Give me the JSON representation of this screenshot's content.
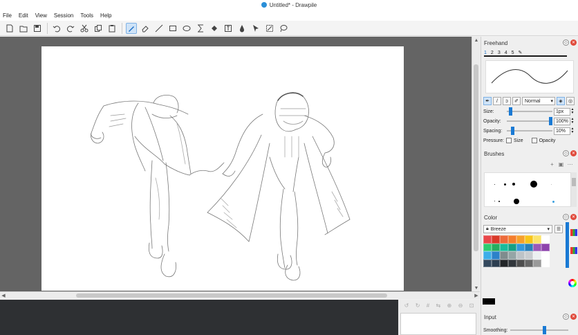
{
  "window": {
    "title": "Untitled* - Drawpile"
  },
  "menu": [
    "File",
    "Edit",
    "View",
    "Session",
    "Tools",
    "Help"
  ],
  "toolbar": {
    "items": [
      {
        "name": "new-icon"
      },
      {
        "name": "open-icon"
      },
      {
        "name": "save-icon"
      },
      {
        "name": "undo-icon"
      },
      {
        "name": "redo-icon"
      },
      {
        "name": "cut-icon"
      },
      {
        "name": "copy-icon"
      },
      {
        "name": "paste-icon"
      },
      {
        "name": "freehand-icon",
        "active": true
      },
      {
        "name": "eraser-icon"
      },
      {
        "name": "line-icon"
      },
      {
        "name": "rectangle-icon"
      },
      {
        "name": "ellipse-icon"
      },
      {
        "name": "gradient-icon"
      },
      {
        "name": "fill-icon"
      },
      {
        "name": "text-icon"
      },
      {
        "name": "picker-icon"
      },
      {
        "name": "pointer-icon"
      },
      {
        "name": "select-icon"
      },
      {
        "name": "lasso-icon"
      }
    ]
  },
  "freehand": {
    "title": "Freehand",
    "presets": [
      "1",
      "2",
      "3",
      "4",
      "5"
    ],
    "blend_mode": "Normal",
    "size_label": "Size:",
    "size_value": "1px",
    "size_level": 0.05,
    "opacity_label": "Opacity:",
    "opacity_value": "100%",
    "opacity_level": 1.0,
    "spacing_label": "Spacing:",
    "spacing_value": "10%",
    "spacing_level": 0.1,
    "pressure_label": "Pressure:",
    "pressure_size": "Size",
    "pressure_opacity": "Opacity"
  },
  "brushes": {
    "title": "Brushes"
  },
  "color": {
    "title": "Color",
    "palette_name": "Breeze",
    "swatches": [
      "#e8474a",
      "#d93a2a",
      "#ed6b3b",
      "#f47e2d",
      "#f6a02a",
      "#f7c51b",
      "#fbe36a",
      "#ffffff",
      "#2ecc71",
      "#27ae60",
      "#1abc9c",
      "#16a085",
      "#3498db",
      "#2980b9",
      "#9b59b6",
      "#8e44ad",
      "#3daee9",
      "#2c82c9",
      "#7f8c8d",
      "#95a5a6",
      "#bdc3c7",
      "#c9cdd0",
      "#ecf0f1",
      "#ffffff",
      "#34495e",
      "#2c3e50",
      "#232629",
      "#31363b",
      "#4d4d4d",
      "#666666",
      "#999999",
      "#ffffff"
    ],
    "current": "#000000"
  },
  "input": {
    "title": "Input",
    "smoothing_label": "Smoothing:",
    "smoothing_level": 0.6
  }
}
